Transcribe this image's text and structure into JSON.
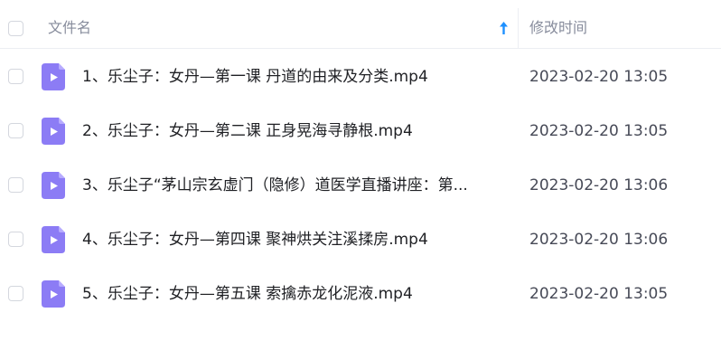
{
  "header": {
    "name_label": "文件名",
    "time_label": "修改时间",
    "sort_icon": "arrow-up-icon",
    "sort_color": "#1e90ff"
  },
  "colors": {
    "file_icon": "#8c7cf5",
    "file_icon_fold": "#b7abff"
  },
  "files": [
    {
      "name": "1、乐尘子：女丹—第一课 丹道的由来及分类.mp4",
      "modified": "2023-02-20 13:05",
      "icon": "video-file-icon"
    },
    {
      "name": "2、乐尘子：女丹—第二课 正身晃海寻静根.mp4",
      "modified": "2023-02-20 13:05",
      "icon": "video-file-icon"
    },
    {
      "name": "3、乐尘子“茅山宗玄虚门（隐修）道医学直播讲座：第...",
      "modified": "2023-02-20 13:06",
      "icon": "video-file-icon"
    },
    {
      "name": "4、乐尘子：女丹—第四课 聚神烘关注溪揉房.mp4",
      "modified": "2023-02-20 13:06",
      "icon": "video-file-icon"
    },
    {
      "name": "5、乐尘子：女丹—第五课 索擒赤龙化泥液.mp4",
      "modified": "2023-02-20 13:05",
      "icon": "video-file-icon"
    }
  ]
}
